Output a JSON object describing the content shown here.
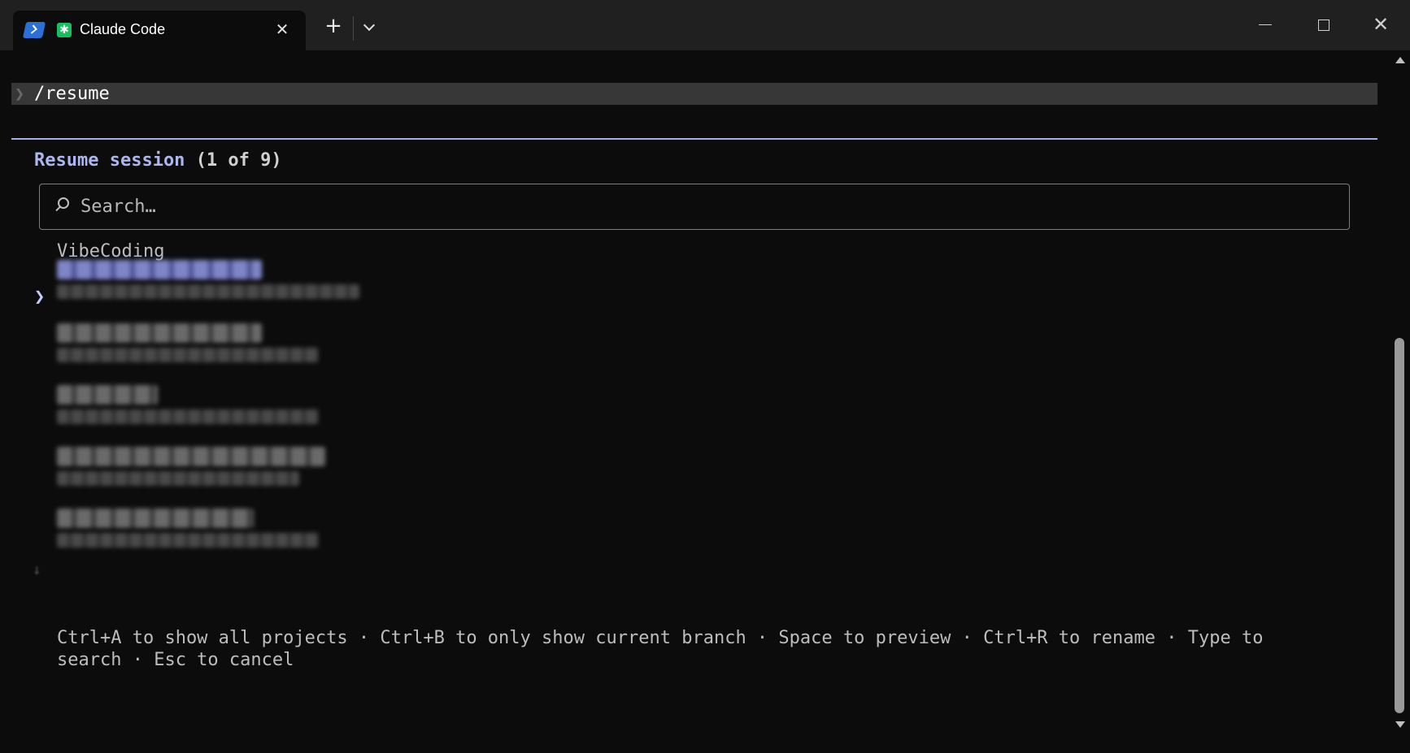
{
  "window": {
    "tab_title": "Claude Code",
    "tab_close_glyph": "✕",
    "app_icon_glyph": "✱",
    "new_tab_glyph": "+",
    "close_glyph": "✕"
  },
  "terminal": {
    "prompt_char": "❯",
    "command": "/resume"
  },
  "resume": {
    "title": "Resume session",
    "count": "(1 of 9)",
    "search_placeholder": "Search…",
    "selector_glyph": "❯",
    "more_glyph": "↓",
    "group_label": "VibeCoding",
    "sessions_count_visible": 5,
    "help_text": "Ctrl+A to show all projects · Ctrl+B to only show current branch · Space to preview · Ctrl+R to rename · Type to\nsearch · Esc to cancel"
  },
  "colors": {
    "accent": "#aeb6f0",
    "selected_title": "#8e96d8",
    "terminal_bg": "#0c0c0c",
    "app_icon": "#16c060"
  }
}
